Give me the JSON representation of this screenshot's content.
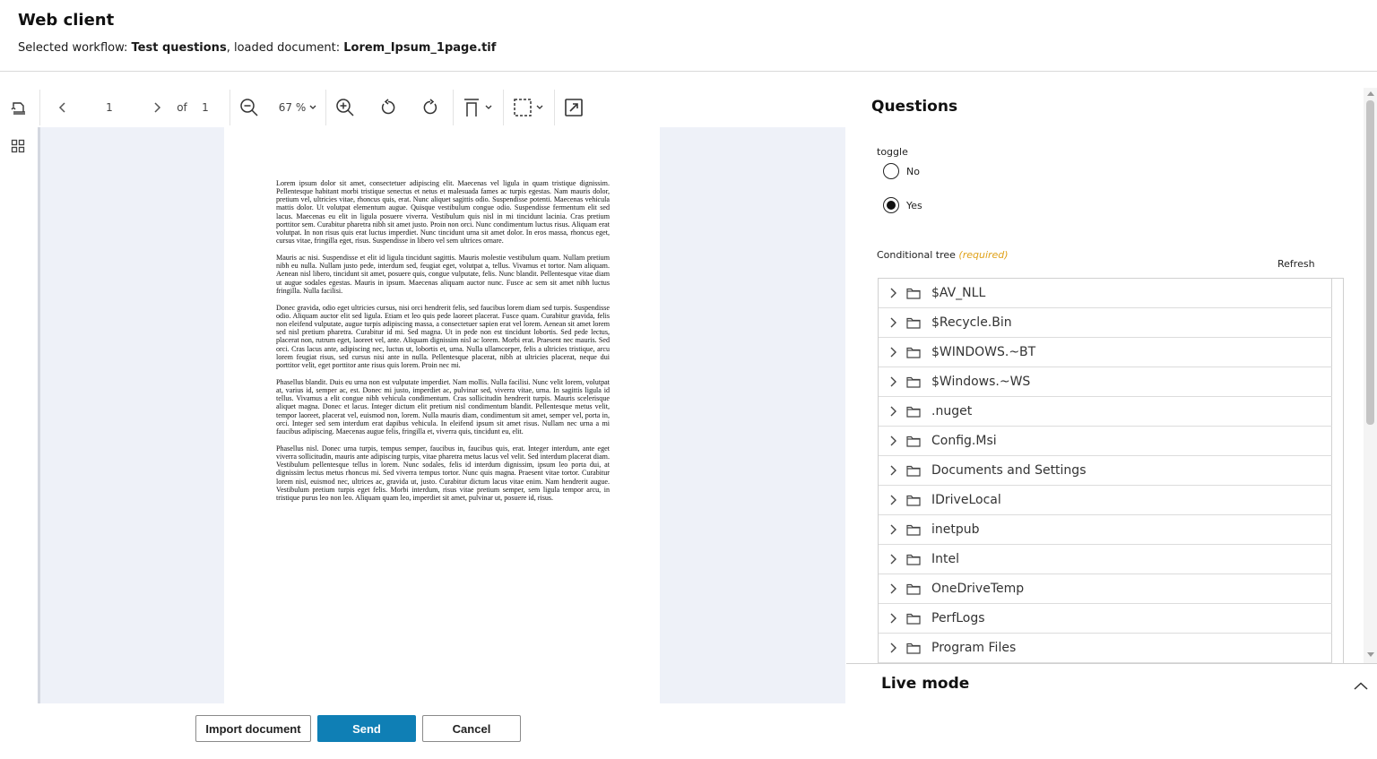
{
  "header": {
    "title": "Web client",
    "subtitle_prefix": "Selected workflow: ",
    "workflow": "Test questions",
    "subtitle_mid": ", loaded document: ",
    "document": "Lorem_Ipsum_1page.tif"
  },
  "toolbar": {
    "page_current": "1",
    "page_of": "of",
    "page_total": "1",
    "zoom": "67 %"
  },
  "document_text": [
    "Lorem ipsum dolor sit amet, consectetuer adipiscing elit. Maecenas vel ligula in quam tristique dignissim. Pellentesque habitant morbi tristique senectus et netus et malesuada fames ac turpis egestas. Nam mauris dolor, pretium vel, ultricies vitae, rhoncus quis, erat. Nunc aliquet sagittis odio. Suspendisse potenti. Maecenas vehicula mattis dolor. Ut volutpat elementum augue. Quisque vestibulum congue odio. Suspendisse fermentum elit sed lacus. Maecenas eu elit in ligula posuere viverra. Vestibulum quis nisl in mi tincidunt lacinia. Cras pretium porttitor sem. Curabitur pharetra nibh sit amet justo. Proin non orci. Nunc condimentum luctus risus. Aliquam erat volutpat. In non risus quis erat luctus imperdiet. Nunc tincidunt urna sit amet dolor. In eros massa, rhoncus eget, cursus vitae, fringilla eget, risus. Suspendisse in libero vel sem ultrices ornare.",
    "Mauris ac nisi. Suspendisse et elit id ligula tincidunt sagittis. Mauris molestie vestibulum quam. Nullam pretium nibh eu nulla. Nullam justo pede, interdum sed, feugiat eget, volutpat a, tellus. Vivamus et tortor. Nam aliquam. Aenean nisl libero, tincidunt sit amet, posuere quis, congue vulputate, felis. Nunc blandit. Pellentesque vitae diam ut augue sodales egestas. Mauris in ipsum. Maecenas aliquam auctor nunc. Fusce ac sem sit amet nibh luctus fringilla. Nulla facilisi.",
    "Donec gravida, odio eget ultricies cursus, nisi orci hendrerit felis, sed faucibus lorem diam sed turpis. Suspendisse odio. Aliquam auctor elit sed ligula. Etiam et leo quis pede laoreet placerat. Fusce quam. Curabitur gravida, felis non eleifend vulputate, augue turpis adipiscing massa, a consectetuer sapien erat vel lorem. Aenean sit amet lorem sed nisl pretium pharetra. Curabitur id mi. Sed magna. Ut in pede non est tincidunt lobortis. Sed pede lectus, placerat non, rutrum eget, laoreet vel, ante. Aliquam dignissim nisl ac lorem. Morbi erat. Praesent nec mauris. Sed orci. Cras lacus ante, adipiscing nec, luctus ut, lobortis et, urna. Nulla ullamcorper, felis a ultricies tristique, arcu lorem feugiat risus, sed cursus nisi ante in nulla. Pellentesque placerat, nibh at ultricies placerat, neque dui porttitor velit, eget porttitor ante risus quis lorem. Proin nec mi.",
    "Phasellus blandit. Duis eu urna non est vulputate imperdiet. Nam mollis. Nulla facilisi. Nunc velit lorem, volutpat at, varius id, semper ac, est. Donec mi justo, imperdiet ac, pulvinar sed, viverra vitae, urna. In sagittis ligula id tellus. Vivamus a elit congue nibh vehicula condimentum. Cras sollicitudin hendrerit turpis. Mauris scelerisque aliquet magna. Donec et lacus. Integer dictum elit pretium nisl condimentum blandit. Pellentesque metus velit, tempor laoreet, placerat vel, euismod non, lorem. Nulla mauris diam, condimentum sit amet, semper vel, porta in, orci. Integer sed sem interdum erat dapibus vehicula. In eleifend ipsum sit amet risus. Nullam nec urna a mi faucibus adipiscing. Maecenas augue felis, fringilla et, viverra quis, tincidunt eu, elit.",
    "Phasellus nisl. Donec urna turpis, tempus semper, faucibus in, faucibus quis, erat. Integer interdum, ante eget viverra sollicitudin, mauris ante adipiscing turpis, vitae pharetra metus lacus vel velit. Sed interdum placerat diam. Vestibulum pellentesque tellus in lorem. Nunc sodales, felis id interdum dignissim, ipsum leo porta dui, at dignissim lectus metus rhoncus mi. Sed viverra tempus tortor. Nunc quis magna. Praesent vitae tortor. Curabitur lorem nisl, euismod nec, ultrices ac, gravida ut, justo. Curabitur dictum lacus vitae enim. Nam hendrerit augue. Vestibulum pretium turpis eget felis. Morbi interdum, risus vitae pretium semper, sem ligula tempor arcu, in tristique purus leo non leo. Aliquam quam leo, imperdiet sit amet, pulvinar ut, posuere id, risus."
  ],
  "buttons": {
    "import": "Import document",
    "send": "Send",
    "cancel": "Cancel"
  },
  "questions": {
    "title": "Questions",
    "toggle_label": "toggle",
    "option_no": "No",
    "option_yes": "Yes",
    "selected": "Yes",
    "tree_label": "Conditional tree",
    "required": "(required)",
    "refresh": "Refresh",
    "tree_items": [
      "$AV_NLL",
      "$Recycle.Bin",
      "$WINDOWS.~BT",
      "$Windows.~WS",
      ".nuget",
      "Config.Msi",
      "Documents and Settings",
      "IDriveLocal",
      "inetpub",
      "Intel",
      "OneDriveTemp",
      "PerfLogs",
      "Program Files"
    ]
  },
  "live_mode": {
    "title": "Live mode"
  },
  "colors": {
    "primary": "#0f7fb5",
    "required": "#e0a21a",
    "viewer_bg": "#eef1f8"
  }
}
